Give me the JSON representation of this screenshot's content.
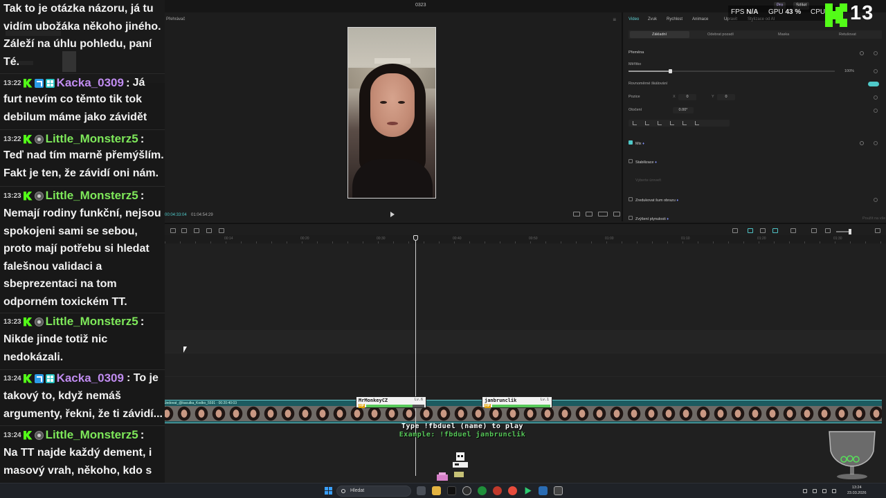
{
  "window": {
    "title": "0323"
  },
  "titlebar_badges": {
    "pro": "Pro",
    "export": "Sdílet"
  },
  "player": {
    "label": "Přehrávač",
    "time_current": "00:04:33:04",
    "time_total": "01:04:54:29"
  },
  "properties": {
    "tabs": [
      "Video",
      "Zvuk",
      "Rychlost",
      "Animace",
      "Upravit",
      "Stylizace od AI"
    ],
    "subtabs": [
      "Základní",
      "Odebrat pozadí",
      "Maska",
      "Retušovat"
    ],
    "transform": "Přeměna",
    "scale_label": "Měřítko",
    "scale_value": "100%",
    "scale_fraction": 0.2,
    "uniform_scale": "Rovnoměrné škálování",
    "position_label": "Pozice",
    "pos_x_label": "X",
    "pos_x": "0",
    "pos_y_label": "Y",
    "pos_y": "0",
    "rotation_label": "Otočení",
    "rotation_value": "0.00°",
    "mix": "Mix",
    "stabilize": "Stabilizace",
    "stabilize_hint": "Vyberte úroveň",
    "noise": "Zredukovat šum obrazu",
    "smooth": "Zvýšení plynulosti",
    "apply_all": "Použít na vše"
  },
  "timeline": {
    "ruler": [
      "00:14",
      "00:20",
      "00:30",
      "00:40",
      "00:50",
      "01:00",
      "01:10",
      "01:20",
      "01:30"
    ],
    "clip_label": "Sledovat_@kaculka_Kodko_5591 · 00:20:40:03"
  },
  "stream": {
    "fps_label": "FPS",
    "fps_value": "N/A",
    "gpu_label": "GPU",
    "gpu_value": "43 %",
    "cpu_label": "CPU",
    "viewer_count": "13"
  },
  "game": {
    "player1": {
      "name": "MrMonkeyCZ",
      "level": "Lv.6",
      "hp": 0.8
    },
    "player2": {
      "name": "janbrunclik",
      "level": "Lv.1",
      "hp": 1.0
    },
    "hp_label": "HP",
    "instruction": "Type !fbduel (name) to play",
    "example": "Example: !fbduel janbrunclik"
  },
  "chat": {
    "messages": [
      {
        "text": "Tak to je otázka názoru, já tu vidím ubožáka někoho jiného. Záleží na úhlu pohledu, paní Té."
      },
      {
        "time": "13:22",
        "user": "Kacka_0309",
        "color": "#c08cf0",
        "text": "Já furt nevím co těmto tik tok debilum máme jako závidět"
      },
      {
        "time": "13:22",
        "user": "Little_Monsterz5",
        "color": "#7ee85a",
        "text": "Teď nad tím marně přemýšlím. Fakt je ten, že závidí oni nám."
      },
      {
        "time": "13:23",
        "user": "Little_Monsterz5",
        "color": "#7ee85a",
        "text": "Nemají rodiny funkční, nejsou spokojeni sami se sebou, proto mají potřebu si hledat falešnou validaci a sbeprezentaci na tom odporném toxickém TT."
      },
      {
        "time": "13:23",
        "user": "Little_Monsterz5",
        "color": "#7ee85a",
        "text": "Nikde jinde totiž nic nedokázali."
      },
      {
        "time": "13:24",
        "user": "Kacka_0309",
        "color": "#c08cf0",
        "text": "To je takový to, když nemáš argumenty, řekni, že ti závidí..."
      },
      {
        "time": "13:24",
        "user": "Little_Monsterz5",
        "color": "#7ee85a",
        "text": "Na TT najde každý dement, i masový vrah, někoho, kdo s ním bude sympatizovat."
      }
    ]
  },
  "taskbar": {
    "search_placeholder": "Hledat",
    "time": "13:24",
    "date": "23.03.2026"
  },
  "colors": {
    "accent": "#4fc9c9",
    "kick_green": "#53fc18"
  }
}
